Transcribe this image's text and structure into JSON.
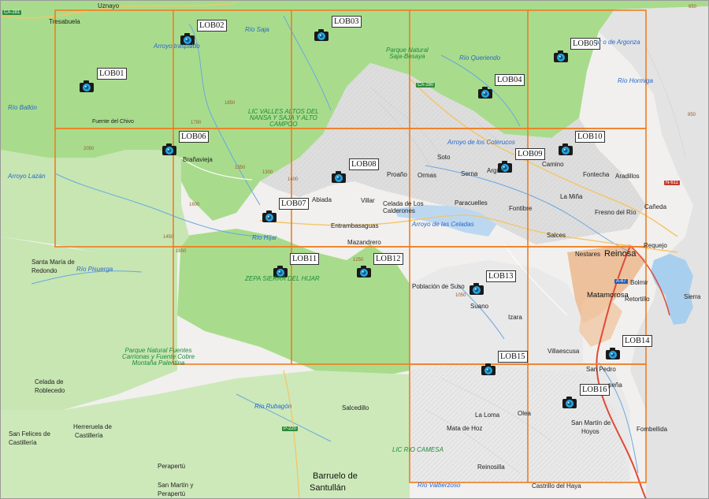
{
  "map": {
    "grid_color": "#ef7d22",
    "forest_color": "#a8dc8c",
    "relief_color": "#d9d9d9",
    "urban_color": "#ebb88d",
    "water_color": "#a9cfee"
  },
  "sheets": [
    {
      "code": "LOB01",
      "icon": "camera-icon"
    },
    {
      "code": "LOB02",
      "icon": "camera-icon"
    },
    {
      "code": "LOB03",
      "icon": "camera-icon"
    },
    {
      "code": "LOB04",
      "icon": "camera-icon"
    },
    {
      "code": "LOB05",
      "icon": "camera-icon"
    },
    {
      "code": "LOB06",
      "icon": "camera-icon"
    },
    {
      "code": "LOB07",
      "icon": "camera-icon"
    },
    {
      "code": "LOB08",
      "icon": "camera-icon"
    },
    {
      "code": "LOB09",
      "icon": "camera-icon"
    },
    {
      "code": "LOB10",
      "icon": "camera-icon"
    },
    {
      "code": "LOB11",
      "icon": "camera-icon"
    },
    {
      "code": "LOB12",
      "icon": "camera-icon"
    },
    {
      "code": "LOB13",
      "icon": "camera-icon"
    },
    {
      "code": "LOB14",
      "icon": "camera-icon"
    },
    {
      "code": "LOB15",
      "icon": "camera-icon"
    },
    {
      "code": "LOB16",
      "icon": "camera-icon"
    }
  ],
  "places": {
    "uznayo": "Uznayo",
    "tresabuela": "Tresabuela",
    "fuente_del_chivo": "Fuente del Chivo",
    "branavieja": "Brañavieja",
    "abiada": "Abiada",
    "villar": "Villar",
    "proano": "Proaño",
    "ormas": "Ormas",
    "soto": "Soto",
    "serna": "Serna",
    "argues": "Argüe",
    "camino": "Camino",
    "fontecha": "Fontecha",
    "aradillos": "Aradillos",
    "la_mina": "La Miña",
    "fontibre": "Fontibre",
    "paracuelles": "Paracuelles",
    "celada_de_los": "Celada de Los",
    "calderones": "Calderones",
    "entrambasaguas": "Entrambasaguas",
    "mazandrero": "Mazandrero",
    "fresno_del_rio": "Fresno del Río",
    "canceda": "Cañeda",
    "salces": "Salces",
    "nestares": "Nestares",
    "reinosa": "Reinosa",
    "requejo": "Requejo",
    "bolmir": "Bolmir",
    "matamorosa": "Matamorosa",
    "retortillo": "Retortillo",
    "sierra": "Sierra",
    "poblacion_de_suso": "Población de Suso",
    "suano": "Suano",
    "izara": "Izara",
    "villaescusa": "Villaescusa",
    "san_pedro": "San Pedro",
    "pena": "peña",
    "fombellida": "Fombellida",
    "san_martin_de": "San Martín de",
    "hoyos": "Hoyos",
    "la_loma": "La Loma",
    "ole": "Olea",
    "mata_de_hoz": "Mata de Hoz",
    "reinosilla": "Reinosilla",
    "castrillo_del_haya": "Castrillo del Haya",
    "salcedillo": "Salcedillo",
    "barruelo_de": "Barruelo de",
    "santullan": "Santullán",
    "santa_maria_de": "Santa María de",
    "redondo": "Redondo",
    "celada_de": "Celada de",
    "roblecedo": "Roblecedo",
    "herreruela_de": "Herreruela de",
    "castilleria": "Castillería",
    "san_felices_de": "San Felices de",
    "castilleria2": "Castillería",
    "perapertu": "Perapertú",
    "san_martin_y": "San Martín y",
    "perapertu2": "Perapertú"
  },
  "water": {
    "rio_ballon": "Río Ballón",
    "arroyo_lazan": "Arroyo Lazán",
    "arroyo_tr": "Arroyo traspaldo",
    "rio_saja": "Río Saja",
    "rio_queriendo": "Río Queriendo",
    "arroyo_argonza": "ar o de Argonza",
    "rio_hormiga": "Río Hormiga",
    "arroyo_coterucos": "Arroyo de los Coterucos",
    "arroyo_celadas": "Arroyo de las Celadas",
    "rio_hijar": "Río Híjar",
    "rio_pisuerga": "Río Pisuerga",
    "rio_rubagon": "Río Rubagón",
    "rio_valberzoso": "Río Valberzoso"
  },
  "parks": {
    "saja_besaya_1": "Parque Natural",
    "saja_besaya_2": "Saja-Besaya",
    "lic_alto_1": "LIC VALLES ALTOS DEL",
    "lic_alto_2": "NANSA Y SAJA Y ALTO",
    "lic_alto_3": "CAMPOO",
    "zepa": "ZEPA SIERRA DEL HIJAR",
    "fuentes_1": "Parque Natural Fuentes",
    "fuentes_2": "Carrionas y Fuente Cobre",
    "fuentes_3": "Montaña Palentina",
    "lic_camesa": "LIC RIO CAMESA"
  },
  "roads": {
    "ca281": "CA-281",
    "ca280": "CA-280",
    "a67": "A-67",
    "p220": "P-220",
    "n611": "N-611"
  },
  "elevations": {
    "e1850": "1850",
    "e1790": "1790",
    "e2050": "2050",
    "e1350": "1350",
    "e1300": "1300",
    "e1400": "1400",
    "e1600": "1600",
    "e1450": "1450",
    "e1850b": "1850",
    "e1250": "1250",
    "e1050": "1050",
    "e850": "850",
    "e650": "650"
  }
}
